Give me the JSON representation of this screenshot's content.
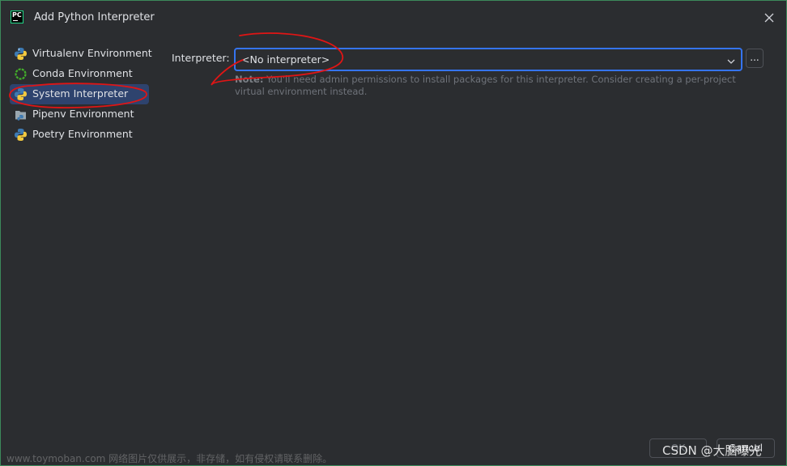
{
  "window": {
    "title": "Add Python Interpreter",
    "accent_color": "#3574f0",
    "selected_color": "#2e436e"
  },
  "logo": {
    "text": "PC"
  },
  "sidebar": {
    "items": [
      {
        "label": "Virtualenv Environment",
        "icon": "python-icon",
        "selected": false
      },
      {
        "label": "Conda Environment",
        "icon": "conda-icon",
        "selected": false
      },
      {
        "label": "System Interpreter",
        "icon": "python-icon",
        "selected": true
      },
      {
        "label": "Pipenv Environment",
        "icon": "pipenv-icon",
        "selected": false
      },
      {
        "label": "Poetry Environment",
        "icon": "python-icon",
        "selected": false
      }
    ]
  },
  "form": {
    "interpreter_label": "Interpreter:",
    "interpreter_value": "<No interpreter>",
    "browse_label": "...",
    "note_prefix": "Note:",
    "note_text": "You'll need admin permissions to install packages for this interpreter. Consider creating a per-project virtual environment instead."
  },
  "footer": {
    "ok_label": "OK",
    "cancel_label": "Cancel"
  },
  "watermark": {
    "left": "www.toymoban.com 网络图片仅供展示，非存储，如有侵权请联系删除。",
    "right": "CSDN @大脑曝光"
  }
}
